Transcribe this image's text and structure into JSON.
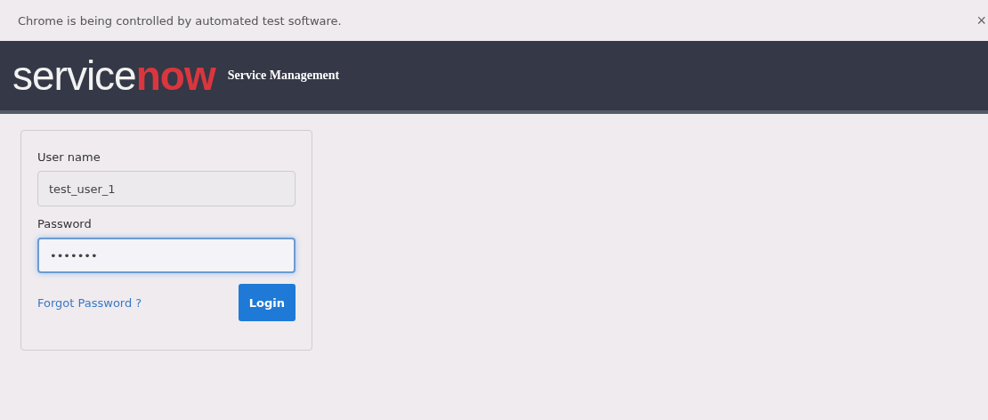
{
  "infobar": {
    "message": "Chrome is being controlled by automated test software.",
    "close": "×"
  },
  "header": {
    "logo_light": "service",
    "logo_accent": "now",
    "subtitle": "Service Management"
  },
  "login": {
    "fields": [
      {
        "label": "User name",
        "value": "test_user_1",
        "focused": false
      },
      {
        "label": "Password",
        "value": "•••••••",
        "focused": true
      }
    ],
    "forgot_link": "Forgot Password ?",
    "button": "Login"
  }
}
